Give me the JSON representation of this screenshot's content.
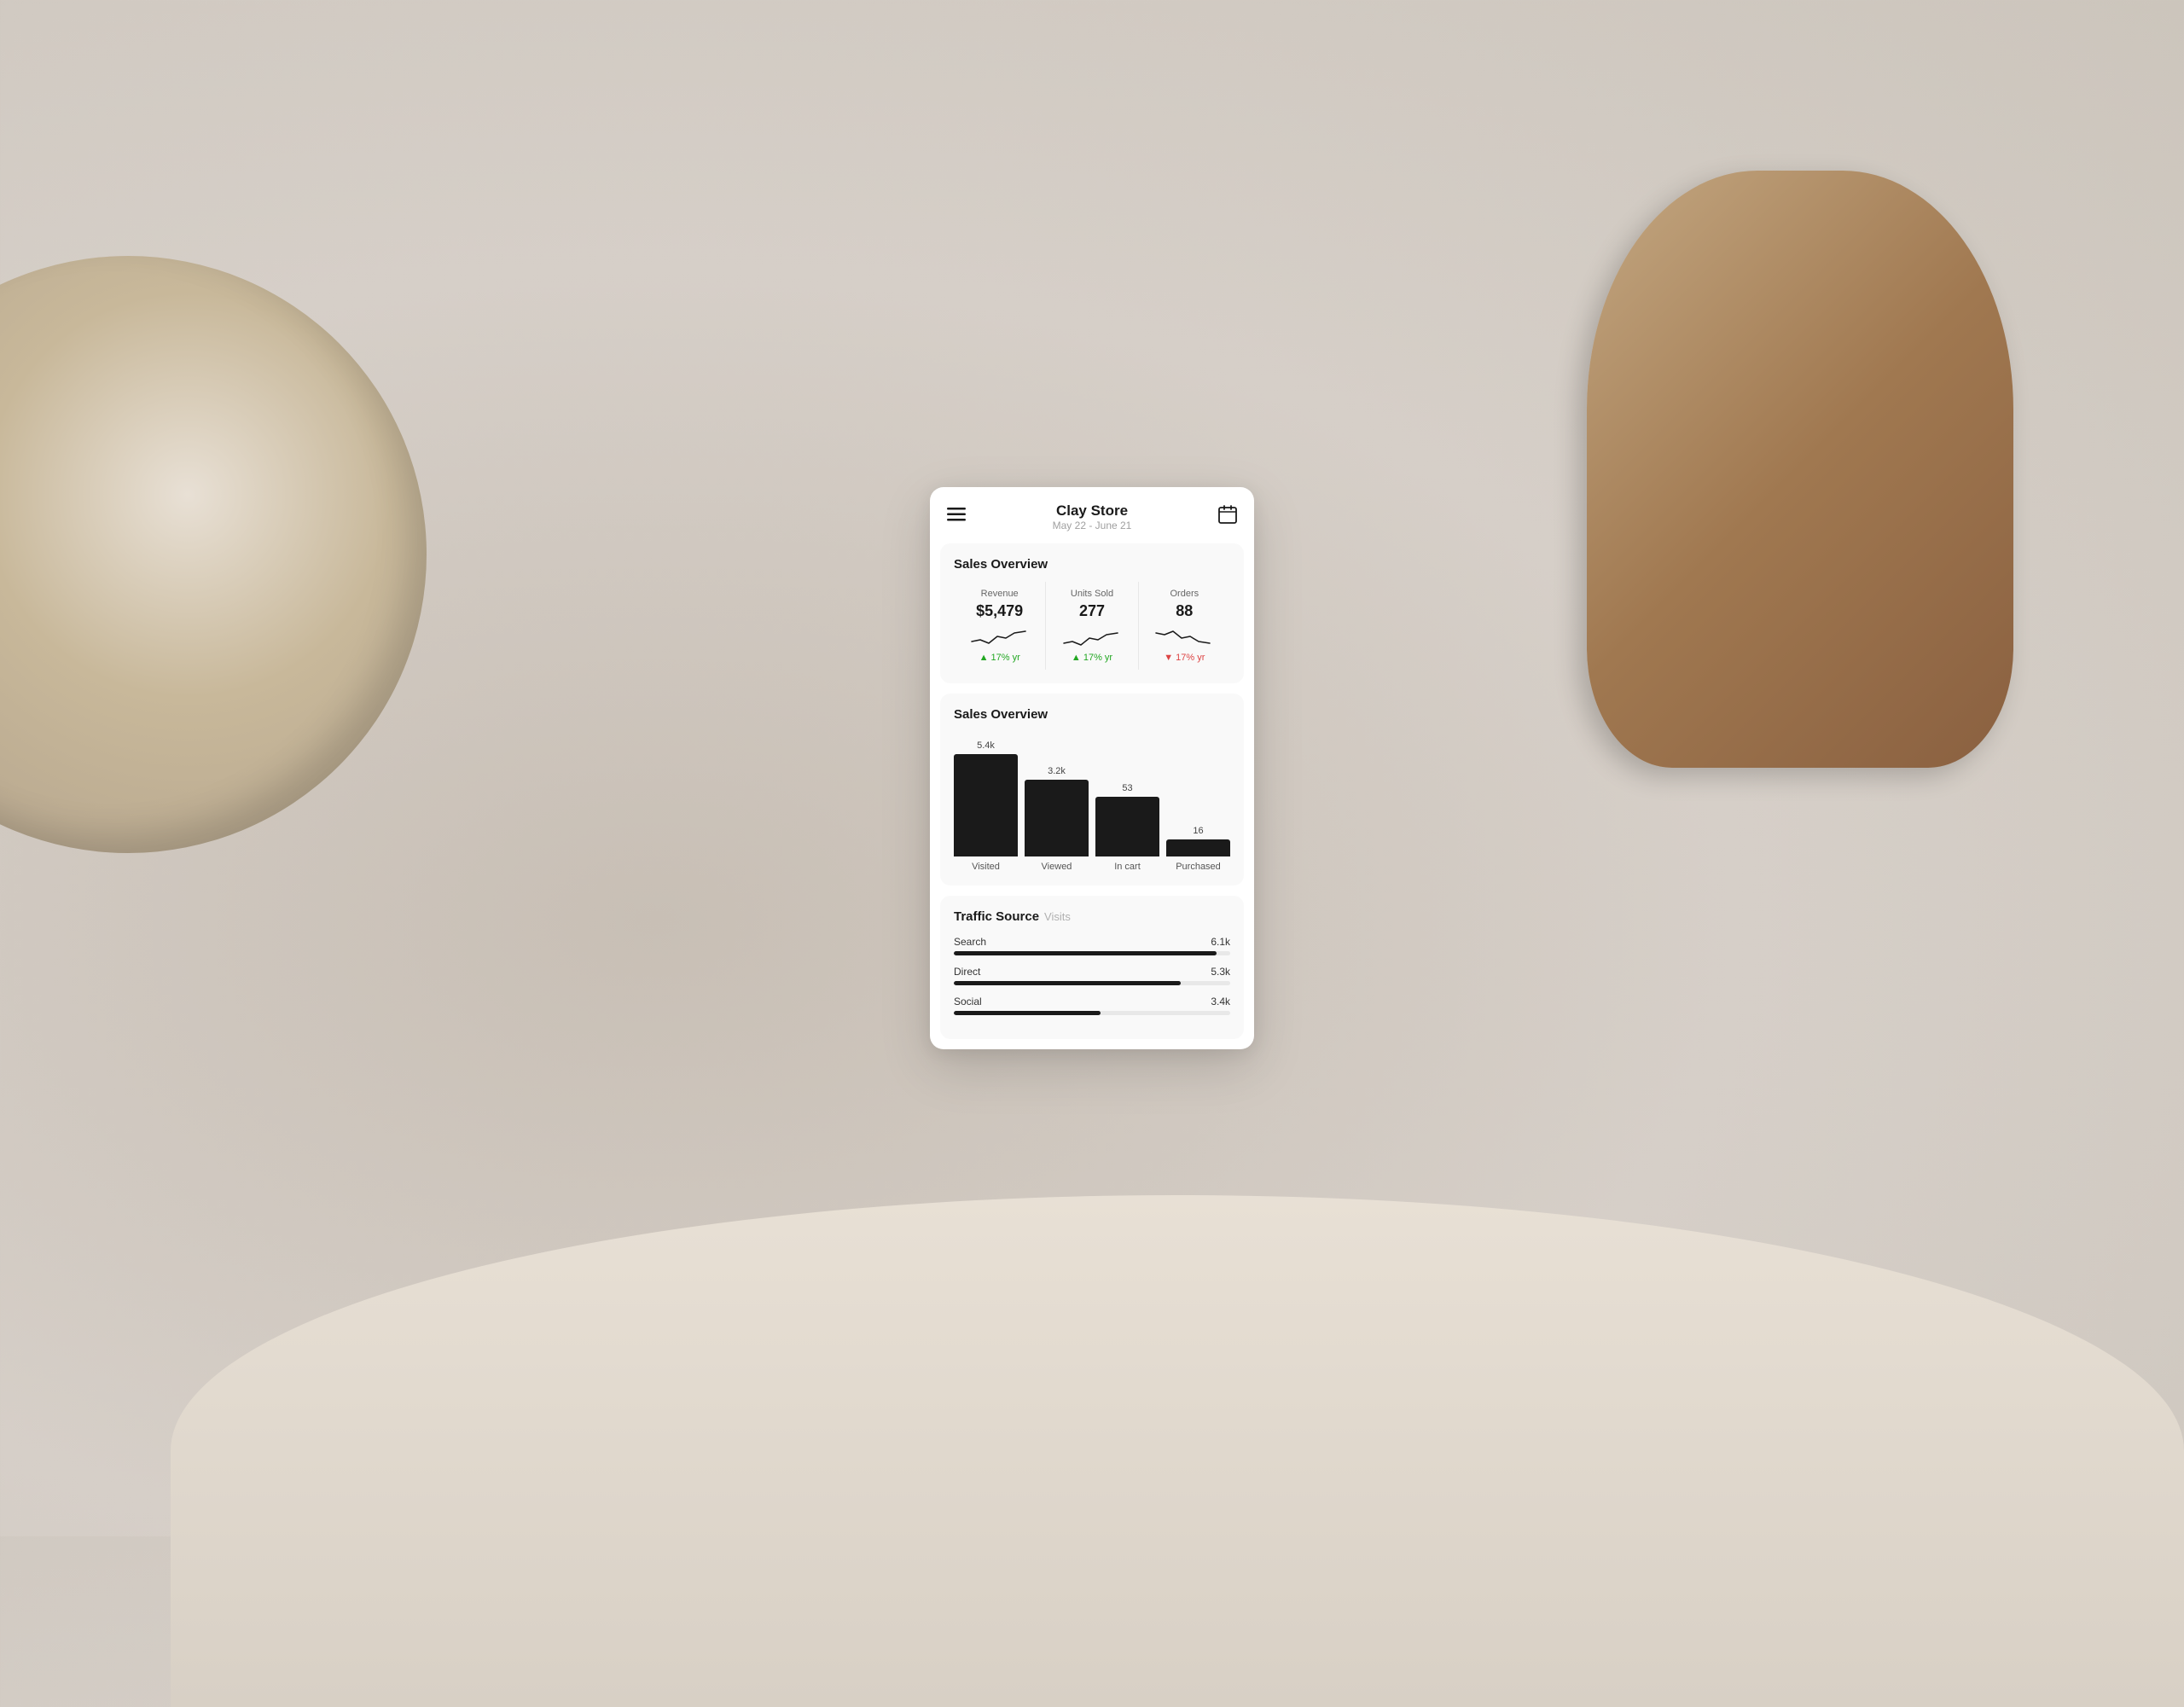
{
  "background": {
    "color": "#d6cfc8"
  },
  "header": {
    "title": "Clay Store",
    "subtitle": "May 22 - June 21",
    "menu_icon": "☰",
    "calendar_icon": "📅"
  },
  "sales_overview_section": {
    "title": "Sales Overview",
    "metrics": [
      {
        "label": "Revenue",
        "value": "$5,479",
        "change": "17% yr",
        "change_type": "positive"
      },
      {
        "label": "Units Sold",
        "value": "277",
        "change": "17% yr",
        "change_type": "positive"
      },
      {
        "label": "Orders",
        "value": "88",
        "change": "17% yr",
        "change_type": "negative"
      }
    ]
  },
  "bar_chart_section": {
    "title": "Sales Overview",
    "bars": [
      {
        "label_top": "5.4k",
        "label_bottom": "Visited",
        "height": 120
      },
      {
        "label_top": "3.2k",
        "label_bottom": "Viewed",
        "height": 90
      },
      {
        "label_top": "53",
        "label_bottom": "In cart",
        "height": 70
      },
      {
        "label_top": "16",
        "label_bottom": "Purchased",
        "height": 20
      }
    ]
  },
  "traffic_section": {
    "title": "Traffic Source",
    "tab_active": "Traffic Source",
    "tab_inactive": "Visits",
    "items": [
      {
        "name": "Search",
        "value": "6.1k",
        "percent": 95
      },
      {
        "name": "Direct",
        "value": "5.3k",
        "percent": 82
      },
      {
        "name": "Social",
        "value": "3.4k",
        "percent": 53
      }
    ]
  }
}
